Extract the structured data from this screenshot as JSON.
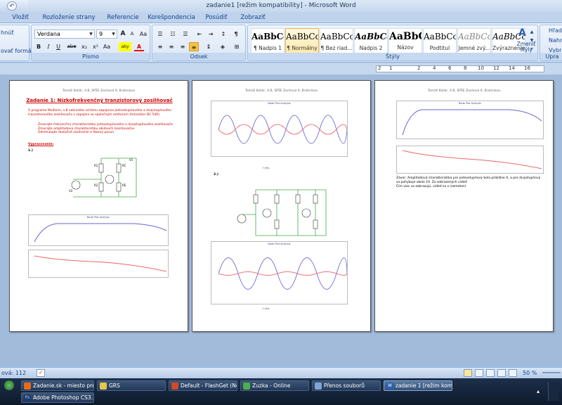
{
  "window": {
    "title": "zadanie1 [režim kompatibility] - Microsoft Word"
  },
  "tabs": [
    "Vložiť",
    "Rozloženie strany",
    "Referencie",
    "Korešpondencia",
    "Posúdiť",
    "Zobraziť"
  ],
  "ribbon": {
    "clipboard": {
      "items": [
        "hnúť",
        "ovať formát"
      ]
    },
    "font": {
      "name": "Verdana",
      "size": "9",
      "grow_label": "A",
      "shrink_label": "A",
      "aa_label": "Aa",
      "bold": "B",
      "italic": "I",
      "underline": "U",
      "strike": "abe",
      "sub": "x₂",
      "sup": "x²",
      "highlight_label": "aby",
      "color_label": "A",
      "group_label": "Písmo"
    },
    "paragraph": {
      "group_label": "Odsek",
      "pilcrow": "¶"
    },
    "styles": {
      "group_label": "Štýly",
      "items": [
        {
          "sample": "AaBbCcI",
          "label": "¶ Nadpis 1"
        },
        {
          "sample": "AaBbCcI",
          "label": "¶ Normálny"
        },
        {
          "sample": "AaBbCcI",
          "label": "¶ Bez riad..."
        },
        {
          "sample": "AaBbCc",
          "label": "Nadpis 2"
        },
        {
          "sample": "AaBbC",
          "label": "Názov"
        },
        {
          "sample": "AaBbCcI",
          "label": "Podtitul"
        },
        {
          "sample": "AaBbCcL",
          "label": "Jemné zvý..."
        },
        {
          "sample": "AaBbCcL",
          "label": "Zvýraznenie"
        }
      ],
      "change_label": "Zmeniť štýly"
    },
    "editing": {
      "group_label": "Upra",
      "items": [
        "Hľad",
        "Nahr",
        "Vybr"
      ]
    }
  },
  "ruler": {
    "marks": [
      "2",
      "1",
      "2",
      "4",
      "6",
      "8",
      "10",
      "12",
      "14",
      "16"
    ]
  },
  "pages": {
    "header": "Tomáš Kollár, 4.B, SPŠE Zochova 9, Bratislava",
    "p1_title": "Zadanie 1: Nízkofrekvenčný tranzistorový zosilňovač",
    "p1_intro": "V programe Multisim, v.8 nakreslite schému zapojenia jednostupňového a dvojstupňového tranzistorového zosilňovača v zapojení so spoločným emitorom (tranzistor BC 546).",
    "p1_list": [
      "Zmerajte frekvenčnú charakteristiku jednostupňového a dvojstupňového zosilňovača",
      "Zmerajte amplitúdovú charakteristiku obidvoch zosilňovačov",
      "Odsimulujte skutočné zosilnenie a fázový posun"
    ],
    "p1_solution": "Vypracovanie:",
    "p1_label": "1.)",
    "p2_label": "2.)",
    "p3_text1": "Záver: Amplitúdová charakteristika pre jednostupňový bola približne A, a pre dvojstupňový sa pohybuje okolo 10. Zo zobrazených vidieť",
    "p3_text2": "Čím viac sa zobrazujú, vidieť sa z rozmetaní",
    "plot_title": "Bode Plot Analysis",
    "xaxis": "f (Hz)"
  },
  "status": {
    "words": "ová: 112",
    "zoom": "50 %"
  },
  "taskbar": {
    "items": [
      {
        "label": "Zadanie.sk - miesto pre...",
        "icon": "firefox-icon"
      },
      {
        "label": "GRS",
        "icon": "folder-icon"
      },
      {
        "label": "Default - FlashGet (Ne...",
        "icon": "flashget-icon"
      },
      {
        "label": "Zuzka - Online",
        "icon": "chat-icon"
      },
      {
        "label": "Přenos souborů",
        "icon": "transfer-icon"
      },
      {
        "label": "zadanie 1 [režim komp...",
        "icon": "word-icon"
      },
      {
        "label": "Adobe Photoshop CS3...",
        "icon": "photoshop-icon"
      }
    ]
  },
  "colors": {
    "accent": "#15428b",
    "ribbon": "#dbe7f6",
    "workspace": "#a2bbdb",
    "taskbar": "#0d1a2c"
  }
}
